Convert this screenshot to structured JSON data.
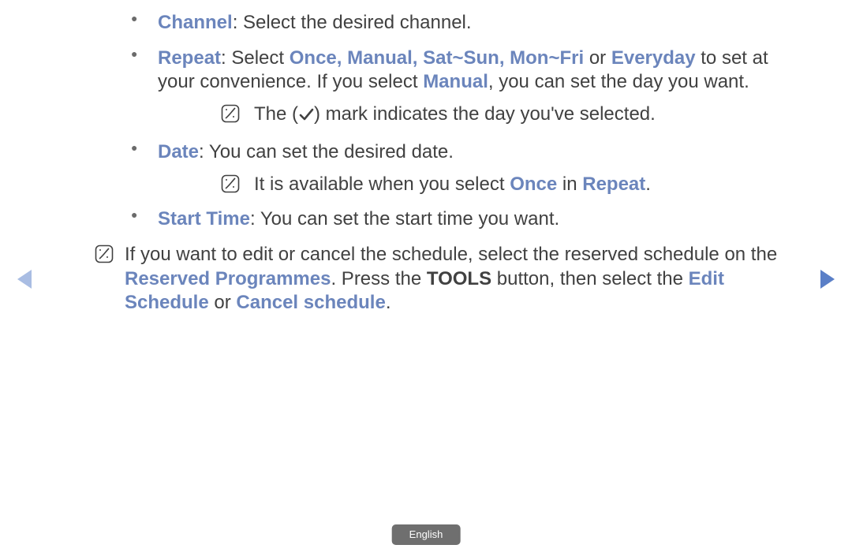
{
  "nav": {
    "left_label": "Previous",
    "right_label": "Next"
  },
  "footer": {
    "language": "English"
  },
  "bullets": {
    "channel": {
      "label": "Channel",
      "text": ": Select the desired channel."
    },
    "repeat": {
      "label": "Repeat",
      "pre": ": Select ",
      "opts": "Once, Manual, Sat~Sun, Mon~Fri",
      "or": " or ",
      "everyday": "Everyday",
      "post": " to set at your convenience. If you select ",
      "manual": "Manual",
      "post2": ", you can set the day you want."
    },
    "repeat_note": {
      "pre": "The (",
      "post": ") mark indicates the day you've selected."
    },
    "date": {
      "label": "Date",
      "text": ": You can set the desired date."
    },
    "date_note": {
      "pre": "It is available when you select ",
      "once": "Once",
      "in": " in ",
      "repeat": "Repeat",
      "post": "."
    },
    "start": {
      "label": "Start Time",
      "text": ": You can set the start time you want."
    }
  },
  "edit_note": {
    "pre": "If you want to edit or cancel the schedule, select the reserved schedule on the ",
    "reserved": "Reserved Programmes",
    "mid1": ". Press the ",
    "tools": "TOOLS",
    "mid2": " button, then select the ",
    "edit": "Edit Schedule",
    "or": " or ",
    "cancel": "Cancel schedule",
    "post": "."
  }
}
